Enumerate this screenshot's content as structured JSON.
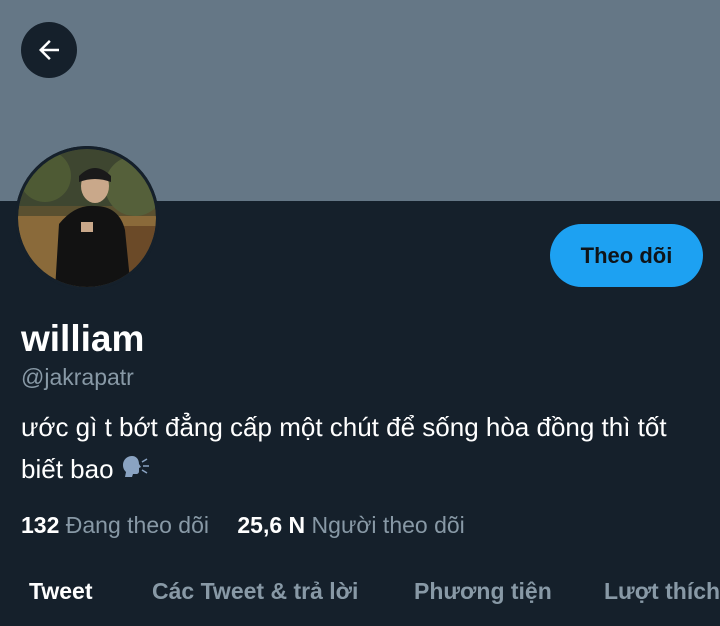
{
  "profile": {
    "display_name": "william",
    "handle": "@jakrapatr",
    "bio": "ước gì t bớt đẳng cấp một chút để sống hòa đồng thì tốt biết bao",
    "bio_emoji": "speaking-head-icon"
  },
  "actions": {
    "follow_label": "Theo dõi",
    "back_icon": "back-arrow-icon"
  },
  "stats": {
    "following_count": "132",
    "following_label": "Đang theo dõi",
    "followers_count": "25,6 N",
    "followers_label": "Người theo dõi"
  },
  "tabs": [
    {
      "label": "Tweet",
      "active": true
    },
    {
      "label": "Các Tweet & trả lời",
      "active": false
    },
    {
      "label": "Phương tiện",
      "active": false
    },
    {
      "label": "Lượt thích",
      "active": false
    }
  ],
  "colors": {
    "background": "#15202b",
    "banner": "#657786",
    "accent": "#1da1f2",
    "secondary_text": "#8899a6"
  }
}
